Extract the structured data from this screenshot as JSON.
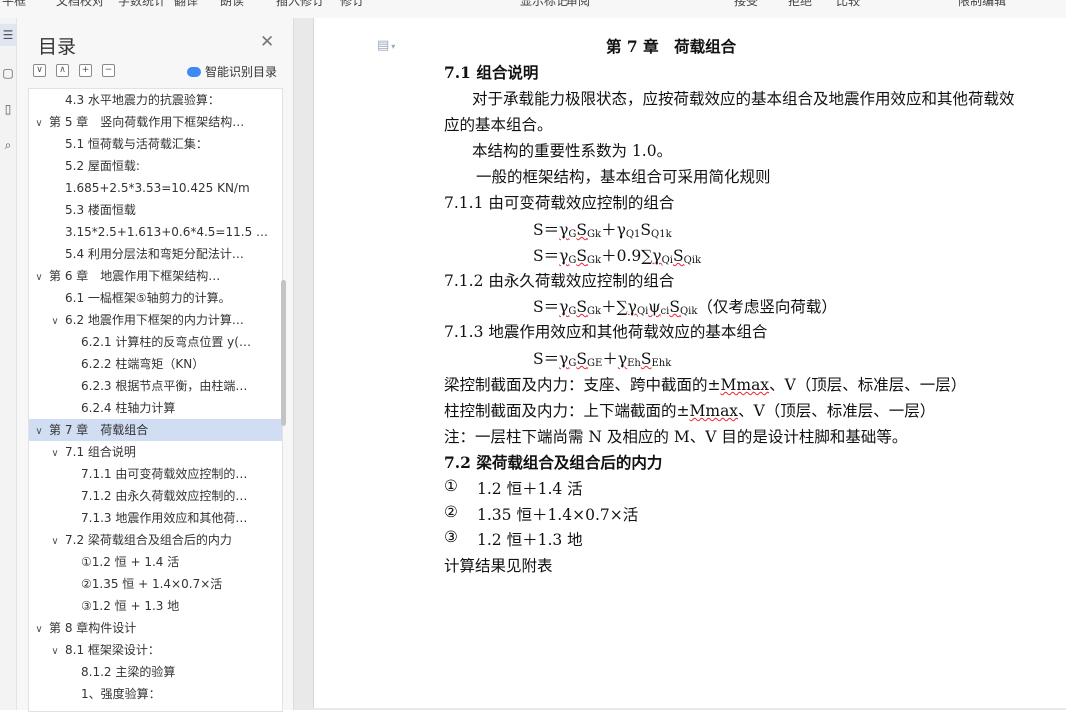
{
  "ribbon": {
    "items": [
      "平框",
      "文档校对",
      "字数统计",
      "翻译",
      "朗读",
      "插入修订",
      "修订",
      "显示标记",
      "审阅",
      "接受",
      "拒绝",
      "比较",
      "限制编辑"
    ]
  },
  "nav": {
    "title": "目录",
    "smart_label": "智能识别目录",
    "tools": [
      "∨",
      "∧",
      "+",
      "−"
    ],
    "items": [
      {
        "label": "4.3 水平地震力的抗震验算：",
        "level": 2,
        "chevron": ""
      },
      {
        "label": "第 5 章　竖向荷载作用下框架结构…",
        "level": 1,
        "chevron": "∨"
      },
      {
        "label": "5.1 恒荷载与活荷载汇集：",
        "level": 2,
        "chevron": ""
      },
      {
        "label": "5.2 屋面恒载:",
        "level": 2,
        "chevron": ""
      },
      {
        "label": "1.685+2.5*3.53=10.425 KN/m",
        "level": 2,
        "chevron": ""
      },
      {
        "label": "5.3 楼面恒载",
        "level": 2,
        "chevron": ""
      },
      {
        "label": "3.15*2.5+1.613+0.6*4.5=11.5 …",
        "level": 2,
        "chevron": ""
      },
      {
        "label": "5.4 利用分层法和弯矩分配法计…",
        "level": 2,
        "chevron": ""
      },
      {
        "label": "第 6 章　地震作用下框架结构…",
        "level": 1,
        "chevron": "∨"
      },
      {
        "label": "6.1 一榀框架⑤轴剪力的计算。",
        "level": 2,
        "chevron": ""
      },
      {
        "label": "6.2 地震作用下框架的内力计算…",
        "level": 2,
        "chevron": "∨"
      },
      {
        "label": "6.2.1 计算柱的反弯点位置 y(…",
        "level": 3,
        "chevron": ""
      },
      {
        "label": "6.2.2 柱端弯矩（KN）",
        "level": 3,
        "chevron": ""
      },
      {
        "label": "6.2.3 根据节点平衡，由柱端…",
        "level": 3,
        "chevron": ""
      },
      {
        "label": "6.2.4 柱轴力计算",
        "level": 3,
        "chevron": ""
      },
      {
        "label": "第 7 章　荷载组合",
        "level": 1,
        "chevron": "∨",
        "selected": true
      },
      {
        "label": "7.1 组合说明",
        "level": 2,
        "chevron": "∨"
      },
      {
        "label": "7.1.1 由可变荷载效应控制的…",
        "level": 3,
        "chevron": ""
      },
      {
        "label": "7.1.2 由永久荷载效应控制的…",
        "level": 3,
        "chevron": ""
      },
      {
        "label": "7.1.3 地震作用效应和其他荷…",
        "level": 3,
        "chevron": ""
      },
      {
        "label": "7.2 梁荷载组合及组合后的内力",
        "level": 2,
        "chevron": "∨"
      },
      {
        "label": "①1.2 恒 + 1.4 活",
        "level": 3,
        "chevron": ""
      },
      {
        "label": "②1.35 恒 + 1.4×0.7×活",
        "level": 3,
        "chevron": ""
      },
      {
        "label": "③1.2 恒 + 1.3 地",
        "level": 3,
        "chevron": ""
      },
      {
        "label": "第 8 章构件设计",
        "level": 1,
        "chevron": "∨"
      },
      {
        "label": "8.1 框架梁设计：",
        "level": 2,
        "chevron": "∨"
      },
      {
        "label": "8.1.2 主梁的验算",
        "level": 3,
        "chevron": ""
      },
      {
        "label": "1、强度验算：",
        "level": 3,
        "chevron": ""
      }
    ]
  },
  "doc": {
    "chapter_title": "第 7 章　荷载组合",
    "s71": "7.1 组合说明",
    "p1a": "对于承载能力极限状态，应按荷载效应的基本组合及地震作用效应和其他荷载效",
    "p1b": "应的基本组合。",
    "p2": "本结构的重要性系数为 1.0。",
    "p3": "一般的框架结构，基本组合可采用简化规则",
    "s711": "7.1.1 由可变荷载效应控制的组合",
    "s712": "7.1.2 由永久荷载效应控制的组合",
    "s712_note": "（仅考虑竖向荷载）",
    "s713": "7.1.3 地震作用效应和其他荷载效应的基本组合",
    "beam_a": "梁控制截面及内力：支座、跨中截面的±",
    "beam_m": "Mmax",
    "beam_b": "、V（顶层、标准层、一层）",
    "col_a": "柱控制截面及内力：上下端截面的±",
    "col_m": "Mmax",
    "col_b": "、V（顶层、标准层、一层）",
    "note": "注：一层柱下端尚需 N 及相应的 M、V 目的是设计柱脚和基础等。",
    "s72": "7.2 梁荷载组合及组合后的内力",
    "c1_num": "①",
    "c1": "1.2 恒＋1.4 活",
    "c2_num": "②",
    "c2": "1.35 恒＋1.4×0.7×活",
    "c3_num": "③",
    "c3": "1.2 恒＋1.3 地",
    "result": "计算结果见附表"
  }
}
